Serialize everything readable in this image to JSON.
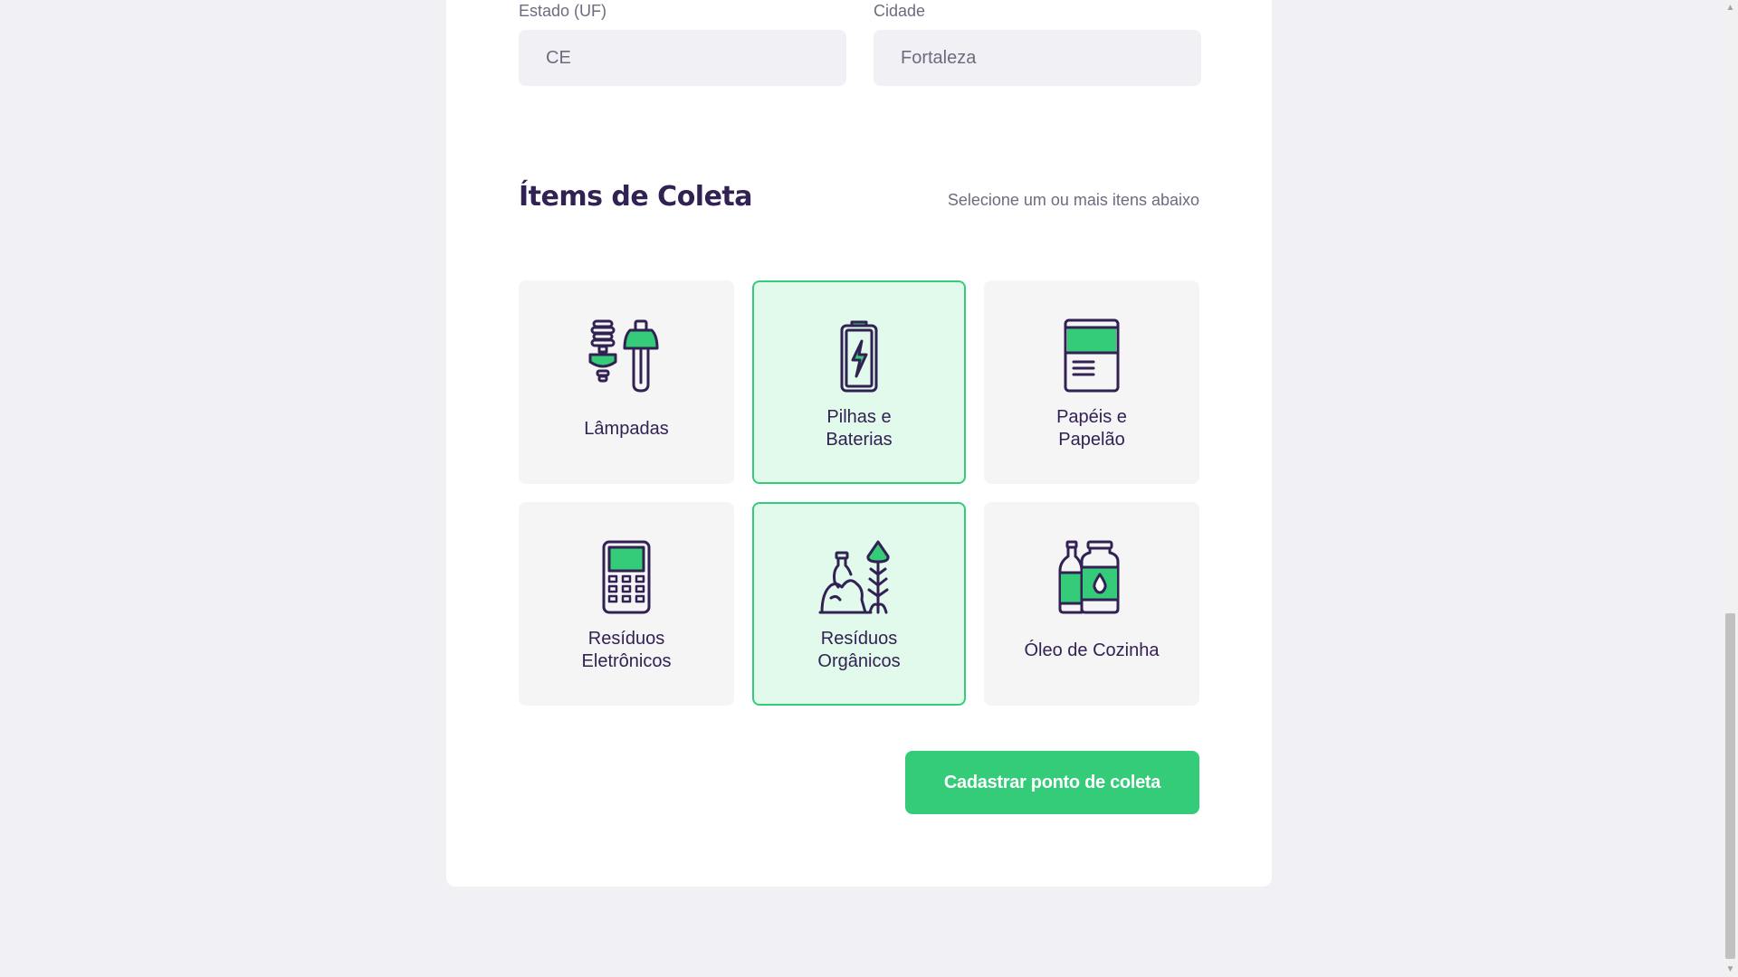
{
  "form": {
    "uf_label": "Estado (UF)",
    "uf_value": "CE",
    "city_label": "Cidade",
    "city_value": "Fortaleza"
  },
  "items_section": {
    "title": "Ítems de Coleta",
    "hint": "Selecione um ou mais itens abaixo",
    "items": [
      {
        "label": "Lâmpadas",
        "icon": "lamp-icon",
        "selected": false
      },
      {
        "label": "Pilhas e Baterias",
        "icon": "battery-icon",
        "selected": true
      },
      {
        "label": "Papéis e Papelão",
        "icon": "paper-icon",
        "selected": false
      },
      {
        "label": "Resíduos Eletrônicos",
        "icon": "electronics-icon",
        "selected": false
      },
      {
        "label": "Resíduos Orgânicos",
        "icon": "organic-waste-icon",
        "selected": true
      },
      {
        "label": "Óleo de Cozinha",
        "icon": "cooking-oil-icon",
        "selected": false
      }
    ]
  },
  "submit_label": "Cadastrar ponto de coleta",
  "colors": {
    "accent": "#34cb79",
    "title": "#322153",
    "muted": "#6c6c80",
    "selected_bg": "#e1faec"
  }
}
